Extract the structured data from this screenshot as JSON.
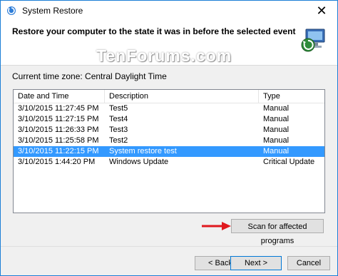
{
  "window": {
    "title": "System Restore",
    "close_glyph": "✕"
  },
  "header": {
    "heading": "Restore your computer to the state it was in before the selected event",
    "watermark": "TenForums.com",
    "icon": "system-restore-icon"
  },
  "timezone_label": "Current time zone: Central Daylight Time",
  "table": {
    "columns": [
      "Date and Time",
      "Description",
      "Type"
    ],
    "rows": [
      {
        "date": "3/10/2015 11:27:45 PM",
        "description": "Test5",
        "type": "Manual",
        "selected": false
      },
      {
        "date": "3/10/2015 11:27:15 PM",
        "description": "Test4",
        "type": "Manual",
        "selected": false
      },
      {
        "date": "3/10/2015 11:26:33 PM",
        "description": "Test3",
        "type": "Manual",
        "selected": false
      },
      {
        "date": "3/10/2015 11:25:58 PM",
        "description": "Test2",
        "type": "Manual",
        "selected": false
      },
      {
        "date": "3/10/2015 11:22:15 PM",
        "description": "System restore test",
        "type": "Manual",
        "selected": true
      },
      {
        "date": "3/10/2015 1:44:20 PM",
        "description": "Windows Update",
        "type": "Critical Update",
        "selected": false
      }
    ]
  },
  "scan_button": "Scan for affected programs",
  "footer": {
    "back": "< Back",
    "next": "Next >",
    "cancel": "Cancel"
  },
  "colors": {
    "selection": "#3399ff",
    "accent": "#0078d7",
    "arrow": "#e0191e"
  }
}
